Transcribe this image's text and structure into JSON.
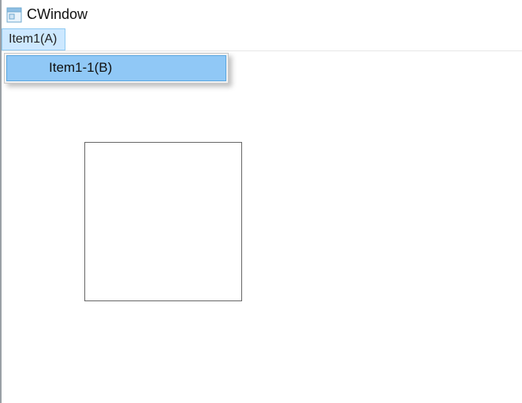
{
  "window": {
    "title": "CWindow"
  },
  "menubar": {
    "items": [
      {
        "label": "Item1(A)"
      }
    ]
  },
  "dropdown": {
    "items": [
      {
        "label": "Item1-1(B)"
      }
    ]
  }
}
